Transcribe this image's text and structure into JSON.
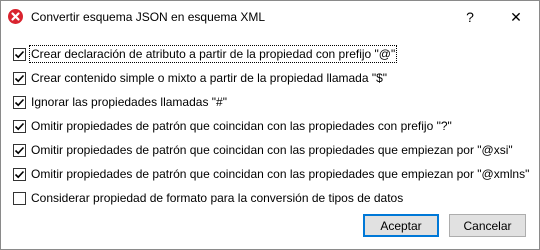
{
  "window": {
    "title": "Convertir esquema JSON en esquema XML",
    "help_label": "?",
    "close_label": "✕",
    "accent_color": "#d9232e"
  },
  "options": [
    {
      "label": "Crear declaración de atributo a partir de la propiedad con prefijo \"@\"",
      "checked": true,
      "focused": true
    },
    {
      "label": "Crear contenido simple o mixto a partir de la propiedad llamada \"$\"",
      "checked": true,
      "focused": false
    },
    {
      "label": "Ignorar las propiedades llamadas \"#\"",
      "checked": true,
      "focused": false
    },
    {
      "label": "Omitir propiedades de patrón que coincidan con las propiedades con prefijo \"?\"",
      "checked": true,
      "focused": false
    },
    {
      "label": "Omitir propiedades de patrón que coincidan con las propiedades que empiezan por \"@xsi\"",
      "checked": true,
      "focused": false
    },
    {
      "label": "Omitir propiedades de patrón que coincidan con las propiedades que empiezan por \"@xmlns\"",
      "checked": true,
      "focused": false
    },
    {
      "label": "Considerar propiedad de formato para la conversión de tipos de datos",
      "checked": false,
      "focused": false
    }
  ],
  "buttons": {
    "accept_label": "Aceptar",
    "cancel_label": "Cancelar"
  }
}
